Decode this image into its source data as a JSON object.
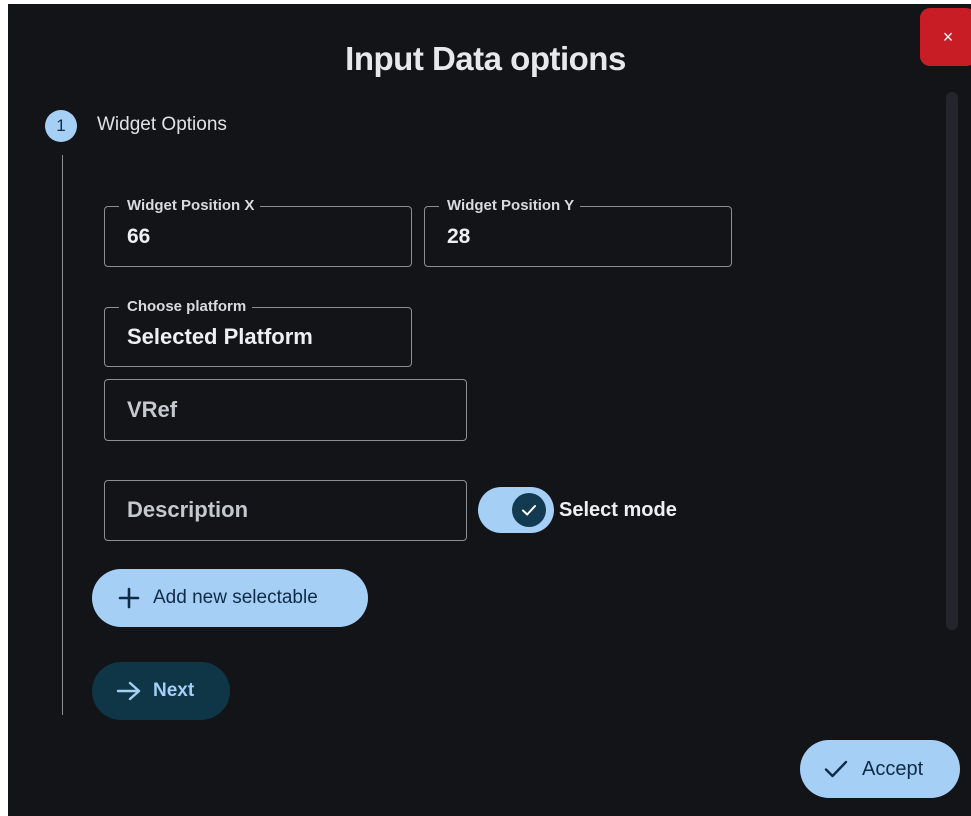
{
  "dialog": {
    "title": "Input Data options",
    "close_label": "×"
  },
  "colors": {
    "background": "#121418",
    "accent": "#a5cff5",
    "close": "#c81d25",
    "next_bg": "#0e3646"
  },
  "stepper": {
    "step_number": "1",
    "step_label": "Widget Options"
  },
  "fields": {
    "position_x": {
      "label": "Widget Position X",
      "value": "66"
    },
    "position_y": {
      "label": "Widget Position Y",
      "value": "28"
    },
    "platform": {
      "label": "Choose platform",
      "value": "Selected Platform"
    },
    "vref": {
      "placeholder": "VRef"
    },
    "description": {
      "placeholder": "Description"
    }
  },
  "toggle": {
    "label": "Select mode",
    "checked": true
  },
  "buttons": {
    "add_selectable": {
      "label": "Add new selectable",
      "icon": "plus-icon"
    },
    "next": {
      "label": "Next",
      "icon": "arrow-right-icon"
    },
    "accept": {
      "label": "Accept",
      "icon": "check-icon"
    }
  }
}
